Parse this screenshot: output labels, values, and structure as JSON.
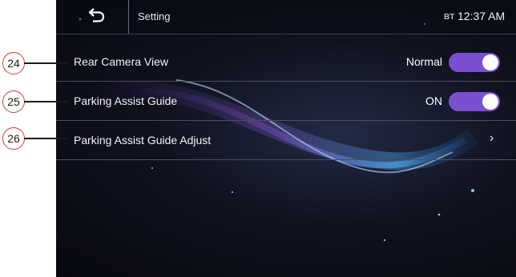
{
  "header": {
    "back_icon": "back-arrow-icon",
    "title": "Setting",
    "bt_label": "BT",
    "time": "12:37 AM"
  },
  "settings": [
    {
      "label": "Rear Camera View",
      "value": "Normal",
      "control": "toggle",
      "state": "on"
    },
    {
      "label": "Parking Assist Guide",
      "value": "ON",
      "control": "toggle",
      "state": "on"
    },
    {
      "label": "Parking Assist Guide Adjust",
      "value": "",
      "control": "chevron",
      "chevron": "›"
    }
  ],
  "callouts": [
    "24",
    "25",
    "26"
  ],
  "colors": {
    "toggle_on": "#7a4fd0",
    "callout_border": "#d43b35",
    "background": "#0b0d18"
  }
}
